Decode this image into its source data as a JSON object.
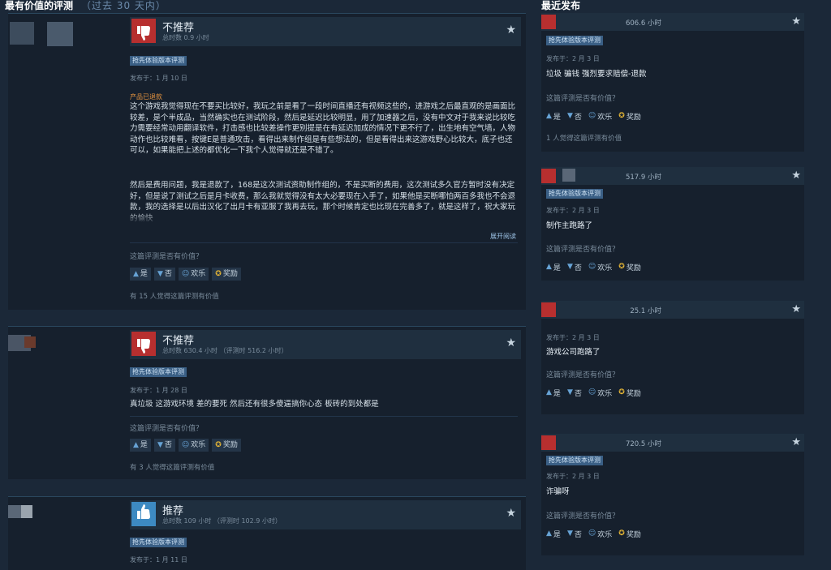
{
  "header": {
    "most_helpful": "最有价值的评测",
    "period": "（过去 30 天内）",
    "recent": "最近发布"
  },
  "buttons": {
    "yes": "是",
    "no": "否",
    "funny": "欢乐",
    "award": "奖励"
  },
  "helpful_question": "这篇评测是否有价值？",
  "reviews": [
    {
      "verdict": "不推荐",
      "hours": "总时数 0.9 小时",
      "badge": "抢先体验版本评测",
      "posted": "发布于：1 月 10 日",
      "refund": "产品已退款",
      "text": "这个游戏我觉得现在不要买比较好，我玩之前是看了一段时间直播还有视频这些的，进游戏之后最直观的是画面比较差，是个半成品，当然确实也在测试阶段，然后是延迟比较明显，用了加速器之后，没有中文对于我来说比较吃力需要经常动用翻译软件，打击感也比较差操作更别提是在有延迟加成的情况下更不行了，出生地有空气墙，人物动作也比较难看，按键E是普通攻击，看得出来制作组是有些想法的，但是看得出来这游戏野心比较大，底子也还可以，如果能把上述的都优化一下我个人觉得就还是不错了。",
      "text2": "然后是费用问题，我是退款了，168是这次测试资助制作组的，不是买断的费用，这次测试多久官方暂时没有决定好，但是说了测试之后是月卡收费，那么我就觉得没有太大必要现在入手了，如果他是买断哪怕两百多我也不会退款，我的选择是以后出汉化了出月卡有亚服了我再去玩，那个时候肯定也比现在完善多了，就是这样了，祝大家玩的愉快",
      "expand": "展开阅读",
      "found": "有 15 人觉得这篇评测有价值"
    },
    {
      "verdict": "不推荐",
      "hours": "总时数 630.4 小时 （评测时 516.2 小时）",
      "badge": "抢先体验版本评测",
      "posted": "发布于：1 月 28 日",
      "text": "真垃圾 这游戏环境 差的要死 然后还有很多傻逼搞你心态 板砖的到处都是",
      "found": "有 3 人觉得这篇评测有价值"
    },
    {
      "verdict": "推荐",
      "hours": "总时数 109 小时 （评测时 102.9 小时）",
      "badge": "抢先体验版本评测",
      "posted": "发布于：1 月 11 日"
    }
  ],
  "recent": [
    {
      "hours": "606.6 小时",
      "badge": "抢先体验版本评测",
      "posted": "发布于：2 月 3 日",
      "text": "垃圾 骗钱 强烈要求赔偿-退款",
      "found": "1 人觉得这篇评测有价值"
    },
    {
      "hours": "517.9 小时",
      "badge": "抢先体验版本评测",
      "posted": "发布于：2 月 3 日",
      "text": "制作主跑路了"
    },
    {
      "hours": "25.1 小时",
      "posted": "发布于：2 月 3 日",
      "text": "游戏公司跑路了"
    },
    {
      "hours": "720.5 小时",
      "badge": "抢先体验版本评测",
      "posted": "发布于：2 月 3 日",
      "text": "诈骗呀"
    }
  ],
  "colors": {
    "thumb_down": "#b72f2f",
    "thumb_up": "#3d8ac2",
    "background": "#1b2838"
  }
}
